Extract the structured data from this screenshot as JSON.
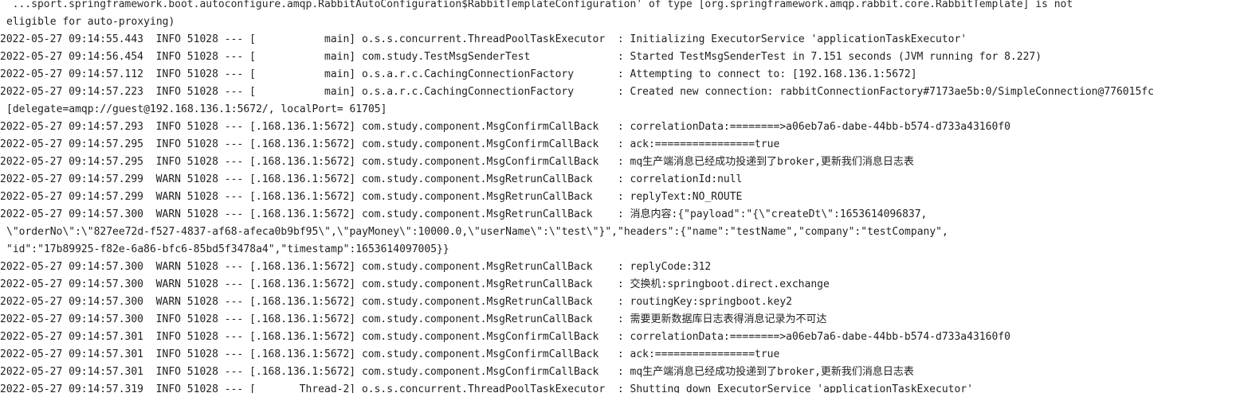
{
  "console": {
    "lines": [
      {
        "text": "  ...sport.springframework.boot.autoconfigure.amqp.RabbitAutoConfiguration$RabbitTemplateConfiguration' of type [org.springframework.amqp.rabbit.core.RabbitTemplate] is not",
        "cont": false
      },
      {
        "text": "eligible for auto-proxying)",
        "cont": true
      },
      {
        "text": "2022-05-27 09:14:55.443  INFO 51028 --- [           main] o.s.s.concurrent.ThreadPoolTaskExecutor  : Initializing ExecutorService 'applicationTaskExecutor'",
        "cont": false
      },
      {
        "text": "2022-05-27 09:14:56.454  INFO 51028 --- [           main] com.study.TestMsgSenderTest              : Started TestMsgSenderTest in 7.151 seconds (JVM running for 8.227)",
        "cont": false
      },
      {
        "text": "2022-05-27 09:14:57.112  INFO 51028 --- [           main] o.s.a.r.c.CachingConnectionFactory       : Attempting to connect to: [192.168.136.1:5672]",
        "cont": false
      },
      {
        "text": "2022-05-27 09:14:57.223  INFO 51028 --- [           main] o.s.a.r.c.CachingConnectionFactory       : Created new connection: rabbitConnectionFactory#7173ae5b:0/SimpleConnection@776015fc",
        "cont": false
      },
      {
        "text": "[delegate=amqp://guest@192.168.136.1:5672/, localPort= 61705]",
        "cont": true
      },
      {
        "text": "2022-05-27 09:14:57.293  INFO 51028 --- [.168.136.1:5672] com.study.component.MsgConfirmCallBack   : correlationData:========>a06eb7a6-dabe-44bb-b574-d733a43160f0",
        "cont": false
      },
      {
        "text": "2022-05-27 09:14:57.295  INFO 51028 --- [.168.136.1:5672] com.study.component.MsgConfirmCallBack   : ack:================true",
        "cont": false
      },
      {
        "text": "2022-05-27 09:14:57.295  INFO 51028 --- [.168.136.1:5672] com.study.component.MsgConfirmCallBack   : mq生产端消息已经成功投递到了broker,更新我们消息日志表",
        "cont": false
      },
      {
        "text": "2022-05-27 09:14:57.299  WARN 51028 --- [.168.136.1:5672] com.study.component.MsgRetrunCallBack    : correlationId:null",
        "cont": false
      },
      {
        "text": "2022-05-27 09:14:57.299  WARN 51028 --- [.168.136.1:5672] com.study.component.MsgRetrunCallBack    : replyText:NO_ROUTE",
        "cont": false
      },
      {
        "text": "2022-05-27 09:14:57.300  WARN 51028 --- [.168.136.1:5672] com.study.component.MsgRetrunCallBack    : 消息内容:{\"payload\":\"{\\\"createDt\\\":1653614096837,",
        "cont": false
      },
      {
        "text": "\\\"orderNo\\\":\\\"827ee72d-f527-4837-af68-afeca0b9bf95\\\",\\\"payMoney\\\":10000.0,\\\"userName\\\":\\\"test\\\"}\",\"headers\":{\"name\":\"testName\",\"company\":\"testCompany\",",
        "cont": true
      },
      {
        "text": "\"id\":\"17b89925-f82e-6a86-bfc6-85bd5f3478a4\",\"timestamp\":1653614097005}}",
        "cont": true
      },
      {
        "text": "2022-05-27 09:14:57.300  WARN 51028 --- [.168.136.1:5672] com.study.component.MsgRetrunCallBack    : replyCode:312",
        "cont": false
      },
      {
        "text": "2022-05-27 09:14:57.300  WARN 51028 --- [.168.136.1:5672] com.study.component.MsgRetrunCallBack    : 交换机:springboot.direct.exchange",
        "cont": false
      },
      {
        "text": "2022-05-27 09:14:57.300  WARN 51028 --- [.168.136.1:5672] com.study.component.MsgRetrunCallBack    : routingKey:springboot.key2",
        "cont": false
      },
      {
        "text": "2022-05-27 09:14:57.300  INFO 51028 --- [.168.136.1:5672] com.study.component.MsgRetrunCallBack    : 需要更新数据库日志表得消息记录为不可达",
        "cont": false
      },
      {
        "text": "2022-05-27 09:14:57.301  INFO 51028 --- [.168.136.1:5672] com.study.component.MsgConfirmCallBack   : correlationData:========>a06eb7a6-dabe-44bb-b574-d733a43160f0",
        "cont": false
      },
      {
        "text": "2022-05-27 09:14:57.301  INFO 51028 --- [.168.136.1:5672] com.study.component.MsgConfirmCallBack   : ack:================true",
        "cont": false
      },
      {
        "text": "2022-05-27 09:14:57.301  INFO 51028 --- [.168.136.1:5672] com.study.component.MsgConfirmCallBack   : mq生产端消息已经成功投递到了broker,更新我们消息日志表",
        "cont": false
      },
      {
        "text": "2022-05-27 09:14:57.319  INFO 51028 --- [       Thread-2] o.s.s.concurrent.ThreadPoolTaskExecutor  : Shutting down ExecutorService 'applicationTaskExecutor'",
        "cont": false
      }
    ]
  }
}
